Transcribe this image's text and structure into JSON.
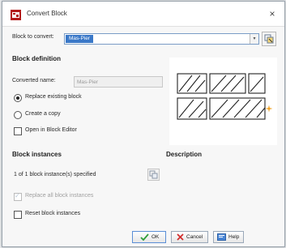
{
  "window": {
    "title": "Convert Block",
    "close_glyph": "×"
  },
  "convert": {
    "label": "Block to convert:",
    "value": "Mas-Pier",
    "arrow": "▾"
  },
  "definition": {
    "heading": "Block definition",
    "converted_name_label": "Converted name:",
    "converted_name_value": "Mas-Pier",
    "option_replace": "Replace existing block",
    "option_copy": "Create a copy",
    "open_in_editor": "Open in Block Editor"
  },
  "instances": {
    "heading": "Block instances",
    "count_text": "1 of 1 block instance(s) specified",
    "replace_all": "Replace all block instances",
    "reset": "Reset block instances"
  },
  "description": {
    "heading": "Description"
  },
  "buttons": {
    "ok": "OK",
    "cancel": "Cancel",
    "help": "Help"
  },
  "colors": {
    "accent": "#3a78c8",
    "ok_check": "#2f9e3a",
    "cancel_x": "#d22f2f",
    "help": "#4a86d6",
    "preview_star": "#f0a020"
  },
  "icons": [
    "block-icon",
    "close-icon",
    "pick-object-icon",
    "select-objects-icon",
    "check-icon",
    "x-icon",
    "help-icon",
    "star-icon"
  ]
}
